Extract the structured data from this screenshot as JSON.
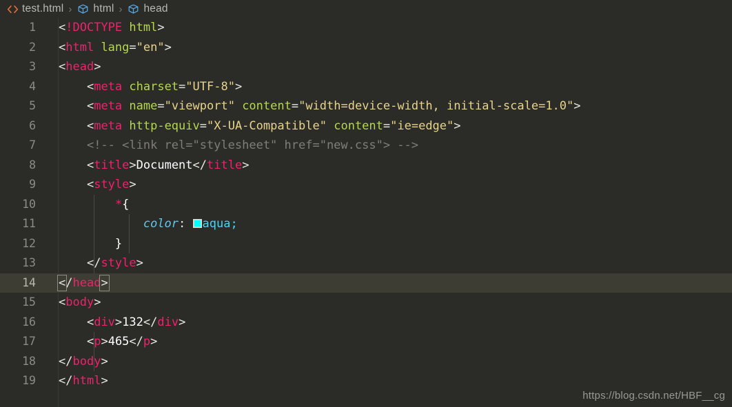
{
  "breadcrumb": {
    "file_icon": "html-code-icon",
    "items": [
      {
        "label": "test.html",
        "icon": "html-code-icon"
      },
      {
        "label": "html",
        "icon": "symbol-module-icon"
      },
      {
        "label": "head",
        "icon": "symbol-module-icon"
      }
    ],
    "separator": "›"
  },
  "editor": {
    "active_line": 14,
    "total_lines": 19,
    "line_numbers": [
      "1",
      "2",
      "3",
      "4",
      "5",
      "6",
      "7",
      "8",
      "9",
      "10",
      "11",
      "12",
      "13",
      "14",
      "15",
      "16",
      "17",
      "18",
      "19"
    ],
    "lines": [
      {
        "n": "1",
        "text": "<!DOCTYPE html>"
      },
      {
        "n": "2",
        "text": "<html lang=\"en\">"
      },
      {
        "n": "3",
        "text": "<head>"
      },
      {
        "n": "4",
        "text": "    <meta charset=\"UTF-8\">"
      },
      {
        "n": "5",
        "text": "    <meta name=\"viewport\" content=\"width=device-width, initial-scale=1.0\">"
      },
      {
        "n": "6",
        "text": "    <meta http-equiv=\"X-UA-Compatible\" content=\"ie=edge\">"
      },
      {
        "n": "7",
        "text": "    <!-- <link rel=\"stylesheet\" href=\"new.css\"> -->"
      },
      {
        "n": "8",
        "text": "    <title>Document</title>"
      },
      {
        "n": "9",
        "text": "    <style>"
      },
      {
        "n": "10",
        "text": "        *{"
      },
      {
        "n": "11",
        "text": "            color: aqua;"
      },
      {
        "n": "12",
        "text": "        }"
      },
      {
        "n": "13",
        "text": "    </style>"
      },
      {
        "n": "14",
        "text": "</head>"
      },
      {
        "n": "15",
        "text": "<body>"
      },
      {
        "n": "16",
        "text": "    <div>132</div>"
      },
      {
        "n": "17",
        "text": "    <p>465</p>"
      },
      {
        "n": "18",
        "text": "</body>"
      },
      {
        "n": "19",
        "text": "</html>"
      }
    ],
    "tokens": {
      "l1_a": "<",
      "l1_b": "!DOCTYPE",
      "l1_c": " html",
      "l1_d": ">",
      "l2_a": "<",
      "l2_b": "html",
      "l2_c": " lang",
      "l2_d": "=",
      "l2_e": "\"en\"",
      "l2_f": ">",
      "l3_a": "<",
      "l3_b": "head",
      "l3_c": ">",
      "l4_indent": "    ",
      "l4_a": "<",
      "l4_b": "meta",
      "l4_c": " charset",
      "l4_d": "=",
      "l4_e": "\"UTF-8\"",
      "l4_f": ">",
      "l5_indent": "    ",
      "l5_a": "<",
      "l5_b": "meta",
      "l5_c": " name",
      "l5_d": "=",
      "l5_e": "\"viewport\"",
      "l5_f": " content",
      "l5_g": "=",
      "l5_h": "\"width=device-width, initial-scale=1.0\"",
      "l5_i": ">",
      "l6_indent": "    ",
      "l6_a": "<",
      "l6_b": "meta",
      "l6_c": " http-equiv",
      "l6_d": "=",
      "l6_e": "\"X-UA-Compatible\"",
      "l6_f": " content",
      "l6_g": "=",
      "l6_h": "\"ie=edge\"",
      "l6_i": ">",
      "l7_indent": "    ",
      "l7_a": "<!-- <link rel=\"stylesheet\" href=\"new.css\"> -->",
      "l8_indent": "    ",
      "l8_a": "<",
      "l8_b": "title",
      "l8_c": ">",
      "l8_d": "Document",
      "l8_e": "</",
      "l8_f": "title",
      "l8_g": ">",
      "l9_indent": "    ",
      "l9_a": "<",
      "l9_b": "style",
      "l9_c": ">",
      "l10_indent": "        ",
      "l10_a": "*",
      "l10_b": "{",
      "l11_indent": "            ",
      "l11_a": "color",
      "l11_b": ": ",
      "l11_c": "aqua;",
      "l12_indent": "        ",
      "l12_a": "}",
      "l13_indent": "    ",
      "l13_a": "</",
      "l13_b": "style",
      "l13_c": ">",
      "l14_a": "<",
      "l14_b": "/",
      "l14_c": "head",
      "l14_d": ">",
      "l15_a": "<",
      "l15_b": "body",
      "l15_c": ">",
      "l16_indent": "    ",
      "l16_a": "<",
      "l16_b": "div",
      "l16_c": ">",
      "l16_d": "132",
      "l16_e": "</",
      "l16_f": "div",
      "l16_g": ">",
      "l17_indent": "    ",
      "l17_a": "<",
      "l17_b": "p",
      "l17_c": ">",
      "l17_d": "465",
      "l17_e": "</",
      "l17_f": "p",
      "l17_g": ">",
      "l18_a": "</",
      "l18_b": "body",
      "l18_c": ">",
      "l19_a": "</",
      "l19_b": "html",
      "l19_c": ">"
    },
    "colors": {
      "background": "#2b2b28",
      "active_line": "#3d3d33",
      "tag": "#f0216d",
      "attribute": "#b5d94c",
      "string": "#e8d48a",
      "comment": "#7f7f78",
      "punctuation": "#e8e8e3",
      "text_content": "#ffffff",
      "css_property": "#62c8e8",
      "css_value": "#42d7f5",
      "swatch_aqua": "#00ffff",
      "line_number": "#8c8c84"
    }
  },
  "watermark": {
    "text": "https://blog.csdn.net/HBF__cg"
  }
}
